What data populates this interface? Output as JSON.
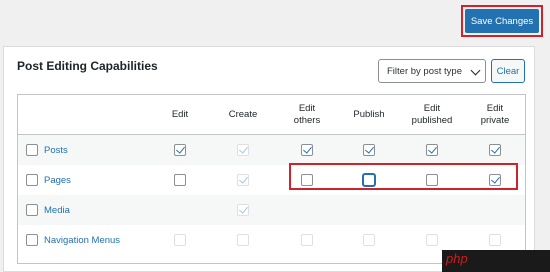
{
  "toolbar": {
    "save_label": "Save Changes"
  },
  "card": {
    "title": "Post Editing Capabilities",
    "filter_label": "Filter by post type",
    "clear_label": "Clear"
  },
  "columns": [
    "Edit",
    "Create",
    "Edit\nothers",
    "Publish",
    "Edit\npublished",
    "Edit\nprivate"
  ],
  "rows": [
    {
      "label": "Posts",
      "cells": [
        {
          "checked": true,
          "disabled": false
        },
        {
          "checked": true,
          "disabled": true
        },
        {
          "checked": true,
          "disabled": false
        },
        {
          "checked": true,
          "disabled": false
        },
        {
          "checked": true,
          "disabled": false
        },
        {
          "checked": true,
          "disabled": false
        }
      ]
    },
    {
      "label": "Pages",
      "cells": [
        {
          "checked": false,
          "disabled": false
        },
        {
          "checked": true,
          "disabled": true
        },
        {
          "checked": false,
          "disabled": false
        },
        {
          "checked": false,
          "disabled": false,
          "focused": true
        },
        {
          "checked": false,
          "disabled": false
        },
        {
          "checked": true,
          "disabled": false
        }
      ]
    },
    {
      "label": "Media",
      "cells": [
        null,
        {
          "checked": true,
          "disabled": true
        },
        null,
        null,
        null,
        null
      ]
    },
    {
      "label": "Navigation Menus",
      "cells": [
        {
          "checked": false,
          "disabled": true
        },
        {
          "checked": false,
          "disabled": true
        },
        {
          "checked": false,
          "disabled": true
        },
        {
          "checked": false,
          "disabled": true
        },
        {
          "checked": false,
          "disabled": true
        },
        {
          "checked": false,
          "disabled": true
        }
      ]
    }
  ],
  "watermark": "php"
}
